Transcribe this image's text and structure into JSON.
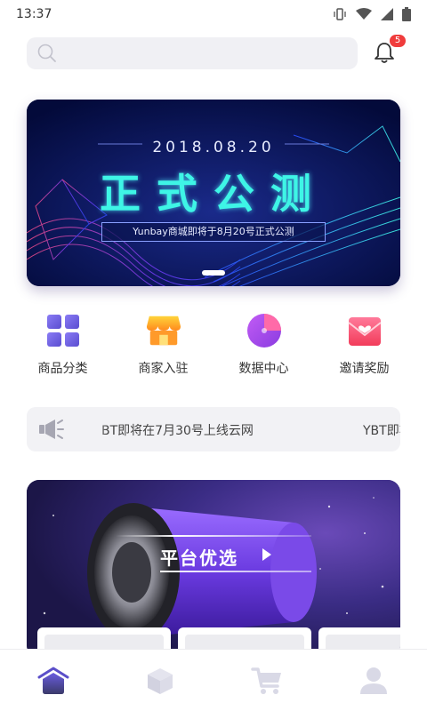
{
  "status_bar": {
    "time": "13:37"
  },
  "search": {
    "value": "",
    "placeholder": ""
  },
  "notifications": {
    "badge_count": "5"
  },
  "banner": {
    "date": "2018.08.20",
    "title": "正式公测",
    "subtitle": "Yunbay商城即将于8月20号正式公测"
  },
  "menu": {
    "items": [
      {
        "label": "商品分类",
        "icon": "grid-icon"
      },
      {
        "label": "商家入驻",
        "icon": "shop-icon"
      },
      {
        "label": "数据中心",
        "icon": "pie-chart-icon"
      },
      {
        "label": "邀请奖励",
        "icon": "envelope-heart-icon"
      }
    ]
  },
  "notice": {
    "icon": "megaphone-icon",
    "items": [
      "BT即将在7月30号上线云网",
      "YBT即将在"
    ]
  },
  "promo": {
    "caption": "平台优选"
  },
  "tabbar": {
    "tabs": [
      {
        "icon": "home-icon",
        "active": true
      },
      {
        "icon": "cube-icon",
        "active": false
      },
      {
        "icon": "cart-icon",
        "active": false
      },
      {
        "icon": "user-icon",
        "active": false
      }
    ]
  },
  "colors": {
    "accent": "#5b4fc9",
    "inactive_icon": "#d9d9e6",
    "badge": "#f03c3c",
    "banner_title": "#3ef5e6"
  }
}
